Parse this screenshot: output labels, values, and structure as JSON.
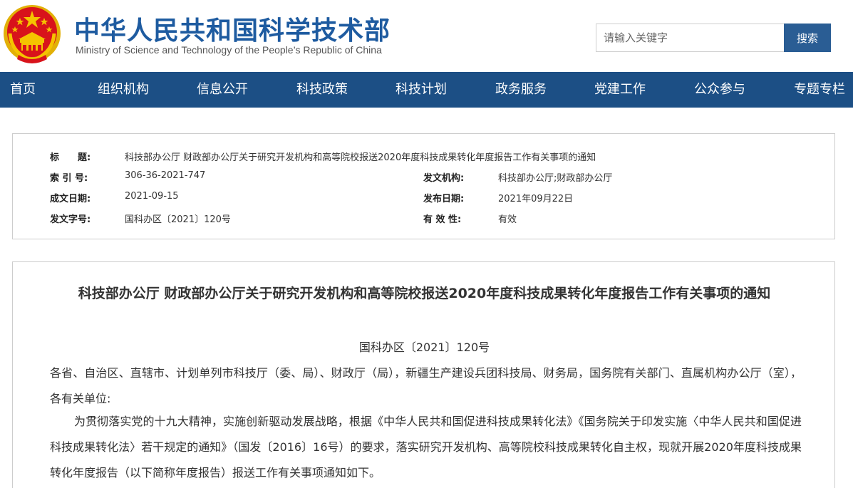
{
  "header": {
    "title": "中华人民共和国科学技术部",
    "subtitle": "Ministry of Science and Technology of the People’s Republic of China",
    "search_placeholder": "请输入关键字",
    "search_button": "搜索",
    "emblem_icon": "national-emblem-icon"
  },
  "nav": {
    "items": [
      "首页",
      "组织机构",
      "信息公开",
      "科技政策",
      "科技计划",
      "政务服务",
      "党建工作",
      "公众参与",
      "专题专栏"
    ]
  },
  "info": {
    "title_label": "标　　题:",
    "title_value": "科技部办公厅 财政部办公厅关于研究开发机构和高等院校报送2020年度科技成果转化年度报告工作有关事项的通知",
    "index_label": "索 引 号:",
    "index_value": "306-36-2021-747",
    "issuer_label": "发文机构:",
    "issuer_value": "科技部办公厅;财政部办公厅",
    "date_label": "成文日期:",
    "date_value": "2021-09-15",
    "publish_label": "发布日期:",
    "publish_value": "2021年09月22日",
    "docno_label": "发文字号:",
    "docno_value": "国科办区〔2021〕120号",
    "validity_label": "有 效 性:",
    "validity_value": "有效"
  },
  "article": {
    "title": "科技部办公厅 财政部办公厅关于研究开发机构和高等院校报送2020年度科技成果转化年度报告工作有关事项的通知",
    "doc_number": "国科办区〔2021〕120号",
    "addressee": "各省、自治区、直辖市、计划单列市科技厅（委、局）、财政厅（局），新疆生产建设兵团科技局、财务局，国务院有关部门、直属机构办公厅（室），各有关单位:",
    "body": "为贯彻落实党的十九大精神，实施创新驱动发展战略，根据《中华人民共和国促进科技成果转化法》《国务院关于印发实施〈中华人民共和国促进科技成果转化法〉若干规定的通知》（国发〔2016〕16号）的要求，落实研究开发机构、高等院校科技成果转化自主权，现就开展2020年度科技成果转化年度报告（以下简称年度报告）报送工作有关事项通知如下。"
  },
  "colors": {
    "brand_blue": "#1e5ba0",
    "nav_bg": "#1c4f85",
    "search_button_bg": "#2a5d94",
    "emblem_red": "#d8131b",
    "emblem_gold": "#f5c400"
  }
}
